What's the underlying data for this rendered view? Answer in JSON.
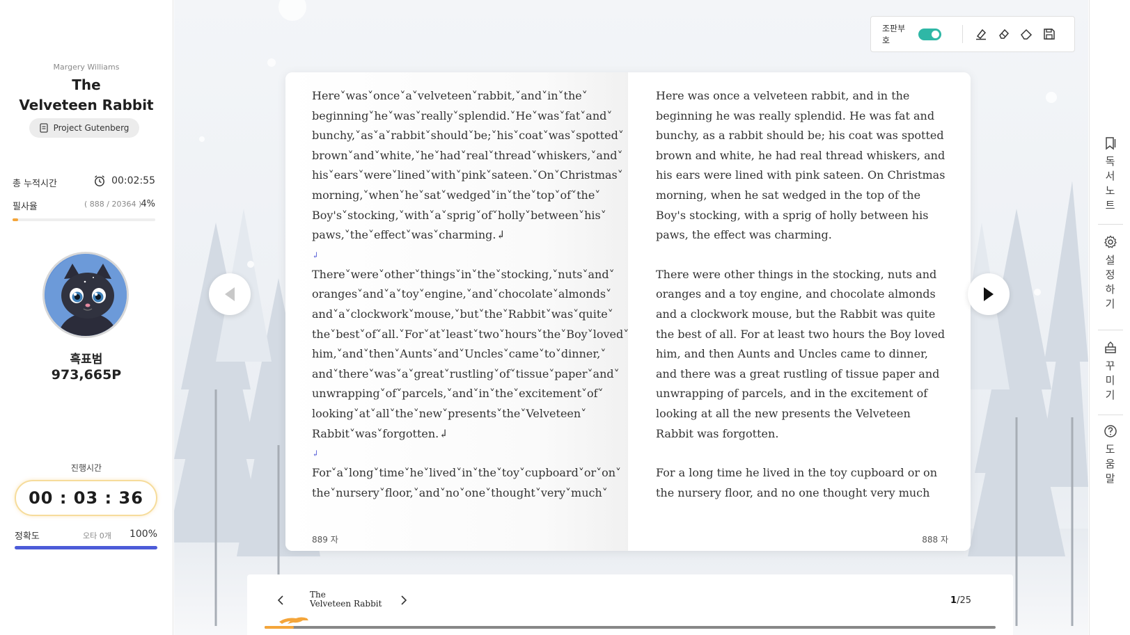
{
  "sidebar": {
    "author": "Margery Williams",
    "title_line1": "The",
    "title_line2": "Velveteen Rabbit",
    "source": "Project Gutenberg",
    "total_time_label": "총 누적시간",
    "total_time": "00:02:55",
    "copy_rate_label": "필사율",
    "copy_ratio": "( 888 / 20364 )",
    "copy_rate": "4%",
    "copy_rate_fraction": 0.04,
    "nickname": "흑표범",
    "points": "973,665P",
    "elapsed_label": "진행시간",
    "elapsed_time": "00 : 03 : 36",
    "accuracy_label": "정확도",
    "typo_count": "오타 0개",
    "accuracy": "100%",
    "accuracy_fraction": 1.0
  },
  "toolbar": {
    "proofmark_label": "조판부호",
    "proofmark_on": true,
    "icons": [
      "highlighter-icon",
      "eraser-icon",
      "clear-icon",
      "save-icon"
    ]
  },
  "book": {
    "left_page": {
      "paragraphs": [
        "Here˅was˅once˅a˅velveteen˅rabbit,˅and˅in˅the˅ beginning˅he˅was˅really˅splendid.˅He˅was˅fat˅and˅ bunchy,˅as˅a˅rabbit˅should˅be;˅his˅coat˅was˅spotted˅ brown˅and˅white,˅he˅had˅real˅thread˅whiskers,˅and˅ his˅ears˅were˅lined˅with˅pink˅sateen.˅On˅Christmas˅ morning,˅when˅he˅sat˅wedged˅in˅the˅top˅of˅the˅ Boy's˅stocking,˅with˅a˅sprig˅of˅holly˅between˅his˅ paws,˅the˅effect˅was˅charming.↲",
        "There˅were˅other˅things˅in˅the˅stocking,˅nuts˅and˅ oranges˅and˅a˅toy˅engine,˅and˅chocolate˅almonds˅ and˅a˅clockwork˅mouse,˅but˅the˅Rabbit˅was˅quite˅ the˅best˅of˅all.˅For˅at˅least˅two˅hours˅the˅Boy˅loved˅ him,˅and˅then˅Aunts˅and˅Uncles˅came˅to˅dinner,˅ and˅there˅was˅a˅great˅rustling˅of˅tissue˅paper˅and˅ unwrapping˅of˅parcels,˅and˅in˅the˅excitement˅of˅ looking˅at˅all˅the˅new˅presents˅the˅Velveteen˅ Rabbit˅was˅forgotten.↲",
        "For˅a˅long˅time˅he˅lived˅in˅the˅toy˅cupboard˅or˅on˅ the˅nursery˅floor,˅and˅no˅one˅thought˅very˅much˅"
      ],
      "pilcrow": "↲",
      "char_count": "889 자"
    },
    "right_page": {
      "paragraphs": [
        "Here was once a velveteen rabbit, and in the beginning he was really splendid. He was fat and bunchy, as a rabbit should be; his coat was spotted brown and white, he had real thread whiskers, and his ears were lined with pink sateen. On Christmas morning, when he sat wedged in the top of the Boy's stocking, with a sprig of holly between his paws, the effect was charming.",
        "There were other things in the stocking, nuts and oranges and a toy engine, and chocolate almonds and a clockwork mouse, but the Rabbit was quite the best of all. For at least two hours the Boy loved him, and then Aunts and Uncles came to dinner, and there was a great rustling of tissue paper and unwrapping of parcels, and in the excitement of looking at all the new presents the Velveteen Rabbit was forgotten.",
        "For a long time he lived in the toy cupboard or on the nursery floor, and no one thought very much"
      ],
      "char_count": "888 자"
    }
  },
  "bottom": {
    "title_line1": "The",
    "title_line2": "Velveteen Rabbit",
    "current_page": "1",
    "total_pages": "/25",
    "progress_fraction": 0.04
  },
  "rail": {
    "items": [
      {
        "icon": "bookmark-icon",
        "label": "독서노트"
      },
      {
        "icon": "gear-icon",
        "label": "설정하기"
      },
      {
        "icon": "decorate-icon",
        "label": "꾸미기"
      },
      {
        "icon": "help-icon",
        "label": "도움말"
      }
    ]
  },
  "colors": {
    "accent_orange": "#f4a53a",
    "toggle_teal": "#2fb7a6",
    "accuracy_blue": "#4c5bd8",
    "mark_purple": "#5a62d8"
  }
}
